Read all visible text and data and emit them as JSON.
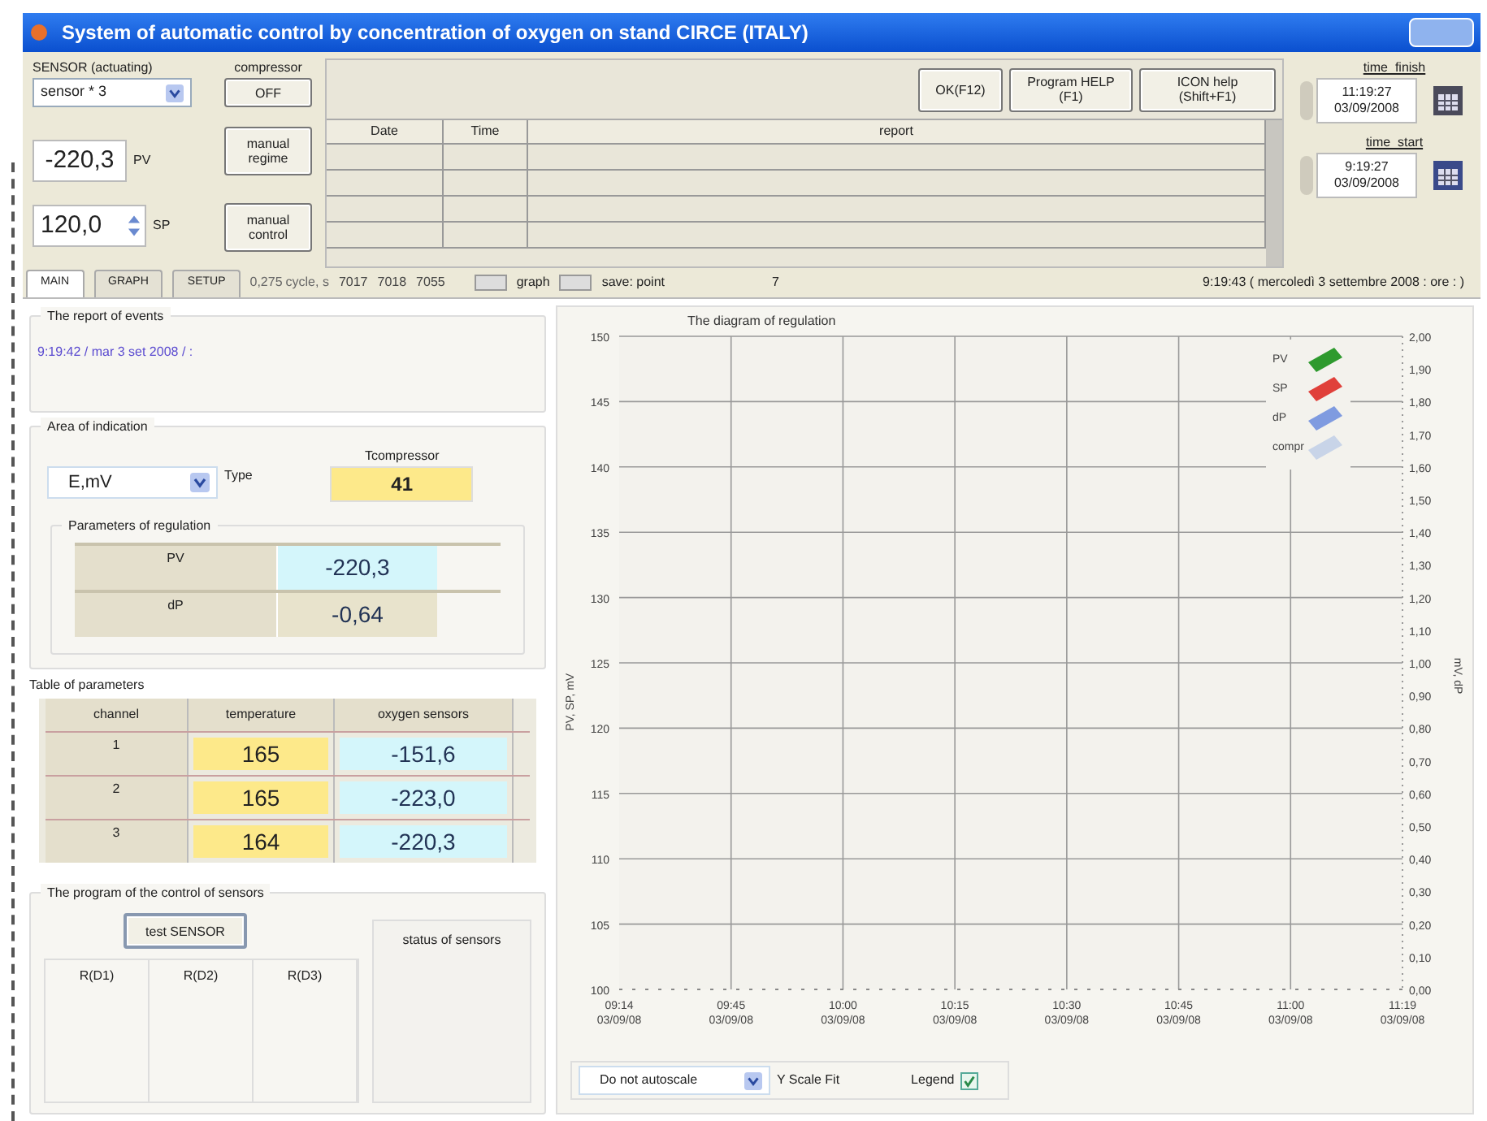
{
  "window": {
    "title": "System of automatic control by concentration of oxygen on stand CIRCE (ITALY)"
  },
  "top": {
    "sensor_label": "SENSOR (actuating)",
    "sensor_value": "sensor * 3",
    "compressor_label": "compressor",
    "compressor_button": "OFF",
    "manual_regime_button": "manual regime",
    "pv": {
      "value": "-220,3",
      "label": "PV"
    },
    "sp": {
      "value": "120,0",
      "label": "SP"
    },
    "manual_control_button": "manual control",
    "buttons": [
      "OK(F12)",
      "Program HELP (F1)",
      "ICON help (Shift+F1)"
    ],
    "report_table": {
      "columns": [
        "Date",
        "Time",
        "report"
      ]
    },
    "time_finish": {
      "label": "time_finish",
      "time": "11:19:27",
      "date": "03/09/2008"
    },
    "time_start": {
      "label": "time_start",
      "time": "9:19:27",
      "date": "03/09/2008"
    }
  },
  "tabs": [
    {
      "label": "MAIN",
      "selected": true
    },
    {
      "label": "GRAPH",
      "selected": false
    },
    {
      "label": "SETUP",
      "selected": false
    }
  ],
  "status_strip": {
    "cycle": "0,275",
    "cycle_label": "cycle, s",
    "codes": [
      "7017",
      "7018",
      "7055"
    ],
    "graph_label": "graph",
    "save_label": "save: point",
    "point": "7",
    "datetime": "9:19:43 ( mercoledì 3 settembre 2008 : ore : )"
  },
  "events": {
    "title": "The report of events",
    "text": "9:19:42 / mar 3 set 2008 / :"
  },
  "indication": {
    "title": "Area of indication",
    "type_value": "E,mV",
    "type_label": "Type",
    "tcompressor_label": "Tcompressor",
    "tcompressor_value": "41"
  },
  "regulation": {
    "title": "Parameters of regulation",
    "rows": [
      {
        "label": "PV",
        "value": "-220,3",
        "kind": "pv"
      },
      {
        "label": "dP",
        "value": "-0,64",
        "kind": "dp"
      }
    ]
  },
  "parameters": {
    "title": "Table of parameters",
    "columns": [
      "channel",
      "temperature",
      "oxygen sensors"
    ],
    "rows": [
      [
        "1",
        "165",
        "-151,6"
      ],
      [
        "2",
        "165",
        "-223,0"
      ],
      [
        "3",
        "164",
        "-220,3"
      ]
    ]
  },
  "sensor_program": {
    "title": "The program of the control of sensors",
    "button": "test SENSOR",
    "columns": [
      "R(D1)",
      "R(D2)",
      "R(D3)"
    ],
    "status_label": "status of sensors"
  },
  "diagram": {
    "title": "The diagram of regulation",
    "chart_data": {
      "type": "line",
      "ylabel": "PV, SP, mV",
      "y2label": "mV, dP",
      "ylim": [
        100,
        150
      ],
      "yticks": [
        100,
        105,
        110,
        115,
        120,
        125,
        130,
        135,
        140,
        145,
        150
      ],
      "grid": true,
      "categories": [
        "09:14 03/09/08",
        "09:45 03/09/08",
        "10:00 03/09/08",
        "10:15 03/09/08",
        "10:30 03/09/08",
        "10:45 03/09/08",
        "11:00 03/09/08",
        "11:19 03/09/08"
      ],
      "y2ticks": [
        "0,00",
        "0,10",
        "0,20",
        "0,30",
        "0,40",
        "0,50",
        "0,60",
        "0,70",
        "0,80",
        "0,90",
        "1,00",
        "1,10",
        "1,20",
        "1,30",
        "1,40",
        "1,50",
        "1,60",
        "1,70",
        "1,80",
        "1,90",
        "2,00"
      ],
      "series": [
        {
          "name": "PV",
          "color": "#2e9a2e",
          "values": [
            null,
            null,
            null,
            null,
            null,
            null,
            null,
            null
          ]
        },
        {
          "name": "SP",
          "color": "#e0403a",
          "values": [
            null,
            null,
            null,
            null,
            null,
            null,
            null,
            null
          ]
        },
        {
          "name": "dP",
          "color": "#7f9be0",
          "values": [
            null,
            null,
            null,
            null,
            null,
            null,
            null,
            null
          ]
        },
        {
          "name": "compr",
          "color": "#c8d4e8",
          "values": [
            null,
            null,
            null,
            null,
            null,
            null,
            null,
            null
          ]
        }
      ]
    },
    "autoscale": "Do not autoscale",
    "scale_fit_label": "Y Scale Fit",
    "legend_label": "Legend",
    "legend_checked": true
  }
}
